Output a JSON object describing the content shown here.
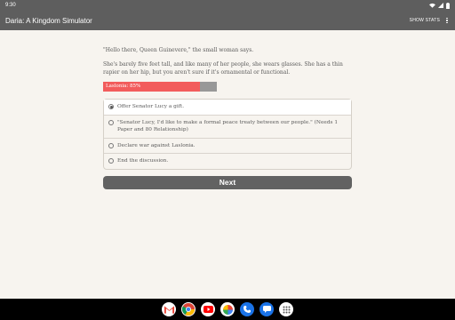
{
  "status_bar": {
    "time": "9:30",
    "icons": [
      "wifi-icon",
      "cellular-icon",
      "battery-icon"
    ]
  },
  "app_bar": {
    "title": "Daria: A Kingdom Simulator",
    "show_stats_label": "SHOW STATS",
    "menu_icon": "more-vert-icon"
  },
  "story": {
    "paragraph_1": "\"Hello there, Queen Guinevere,\" the small woman says.",
    "paragraph_2": "She's barely five feet tall, and like many of her people, she wears glasses. She has a thin rapier on her hip, but you aren't sure if it's ornamental or functional."
  },
  "stat_bar": {
    "label": "Laslonia: 85%",
    "value_fraction": 0.85,
    "fill_color": "#f25c5c",
    "track_color": "#989898"
  },
  "choices": [
    {
      "text": "Offer Senator Lucy a gift.",
      "selected": true
    },
    {
      "text": "\"Senator Lucy, I'd like to make a formal peace treaty between our people.\" (Needs 1 Paper and 80 Relationship)",
      "selected": false
    },
    {
      "text": "Declare war against Laslonia.",
      "selected": false
    },
    {
      "text": "End the discussion.",
      "selected": false
    }
  ],
  "next_button": {
    "label": "Next"
  },
  "dock": {
    "apps": [
      "gmail-icon",
      "chrome-icon",
      "youtube-icon",
      "photos-icon",
      "phone-icon",
      "messages-icon",
      "app-drawer-icon"
    ]
  },
  "colors": {
    "bar_gray": "#5e5e5e",
    "page_bg": "#f7f4ef",
    "button_gray": "#626262"
  }
}
